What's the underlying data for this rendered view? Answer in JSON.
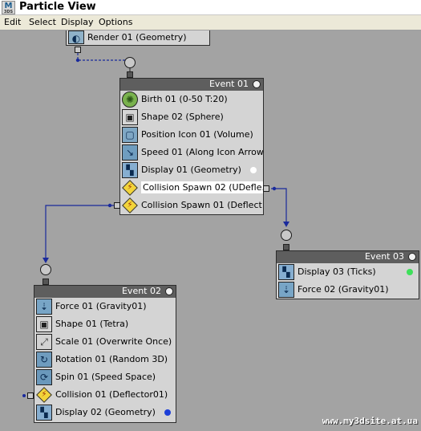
{
  "window": {
    "title": "Particle View",
    "logo_top": "M",
    "logo_bottom": "3DS"
  },
  "menu": [
    "Edit",
    "Select",
    "Display",
    "Options"
  ],
  "render_node": {
    "label": "Render 01 (Geometry)"
  },
  "event01": {
    "title": "Event 01",
    "operators": [
      "Birth 01 (0-50 T:20)",
      "Shape 02 (Sphere)",
      "Position Icon 01 (Volume)",
      "Speed 01 (Along Icon Arrow)",
      "Display 01 (Geometry)",
      "Collision Spawn 02 (UDefle...",
      "Collision Spawn 01 (Deflect..."
    ],
    "display_color": "#ffffff"
  },
  "event02": {
    "title": "Event 02",
    "operators": [
      "Force 01 (Gravity01)",
      "Shape 01 (Tetra)",
      "Scale 01 (Overwrite Once)",
      "Rotation 01 (Random 3D)",
      "Spin 01 (Speed Space)",
      "Collision 01 (Deflector01)",
      "Display 02 (Geometry)"
    ],
    "display_color": "#1d3fd8"
  },
  "event03": {
    "title": "Event 03",
    "operators": [
      "Display 03 (Ticks)",
      "Force 02 (Gravity01)"
    ],
    "display_color": "#3ee05a"
  },
  "watermark": "www.my3dsite.at.ua",
  "colors": {
    "wire": "#1a2a9c",
    "canvas": "#a3a3a3",
    "header": "#5e5e5e"
  }
}
